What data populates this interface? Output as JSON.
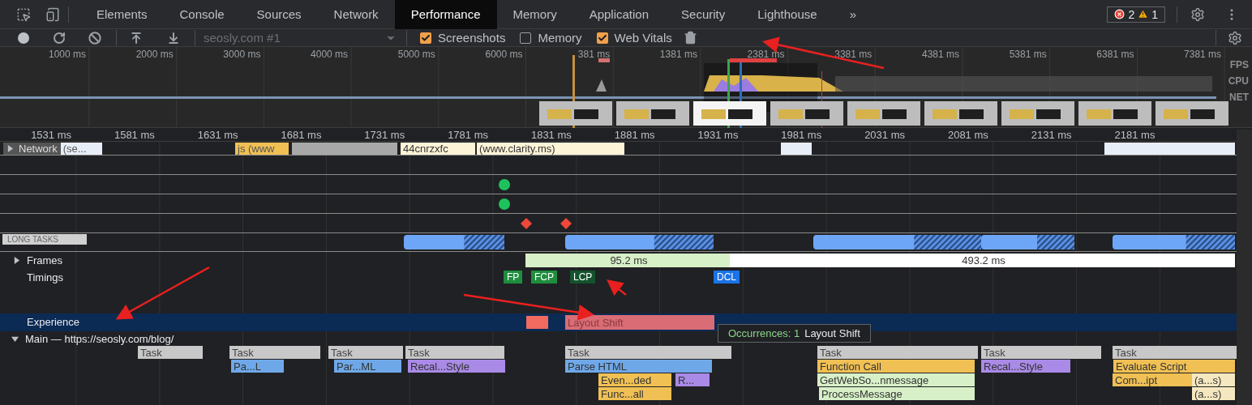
{
  "tabs": [
    {
      "label": "Elements",
      "selected": false
    },
    {
      "label": "Console",
      "selected": false
    },
    {
      "label": "Sources",
      "selected": false
    },
    {
      "label": "Network",
      "selected": false
    },
    {
      "label": "Performance",
      "selected": true
    },
    {
      "label": "Memory",
      "selected": false
    },
    {
      "label": "Application",
      "selected": false
    },
    {
      "label": "Security",
      "selected": false
    },
    {
      "label": "Lighthouse",
      "selected": false
    }
  ],
  "more_tabs": "»",
  "issues": {
    "errors": "2",
    "warnings": "1"
  },
  "toolbar": {
    "profile_select": "seosly.com #1",
    "checkboxes": [
      {
        "label": "Screenshots",
        "checked": true
      },
      {
        "label": "Memory",
        "checked": false
      },
      {
        "label": "Web Vitals",
        "checked": true
      }
    ]
  },
  "overview": {
    "ticks": [
      "1000 ms",
      "2000 ms",
      "3000 ms",
      "4000 ms",
      "5000 ms",
      "6000 ms",
      "381 ms",
      "1381 ms",
      "2381 ms",
      "3381 ms",
      "4381 ms",
      "5381 ms",
      "6381 ms",
      "7381 ms"
    ],
    "lane_labels": [
      "FPS",
      "CPU",
      "NET"
    ]
  },
  "ruler": [
    "1531 ms",
    "1581 ms",
    "1631 ms",
    "1681 ms",
    "1731 ms",
    "1781 ms",
    "1831 ms",
    "1881 ms",
    "1931 ms",
    "1981 ms",
    "2031 ms",
    "2081 ms",
    "2131 ms",
    "2181 ms"
  ],
  "network": {
    "label": "Network",
    "expanded": false,
    "requests": [
      "(se...",
      "js (www",
      "44cnrzxfc",
      "(www.clarity.ms)"
    ]
  },
  "long_tasks": {
    "label": "LONG TASKS"
  },
  "frames": {
    "label": "Frames",
    "expanded": false,
    "durations": [
      "95.2 ms",
      "493.2 ms"
    ]
  },
  "timings": {
    "label": "Timings",
    "markers": [
      {
        "label": "FP",
        "color": "#1e8e3e"
      },
      {
        "label": "FCP",
        "color": "#1e8e3e"
      },
      {
        "label": "LCP",
        "color": "#14532d"
      },
      {
        "label": "DCL",
        "color": "#1a73e8"
      }
    ]
  },
  "experience": {
    "label": "Experience",
    "selected": true,
    "events": [
      "Layout Shift"
    ]
  },
  "tooltip": {
    "count": "Occurrences: 1",
    "text": "Layout Shift"
  },
  "main": {
    "label": "Main — https://seosly.com/blog/",
    "expanded": true,
    "rows": [
      {
        "events": [
          {
            "label": "Task",
            "kind": "task"
          },
          {
            "label": "Task",
            "kind": "task"
          },
          {
            "label": "Task",
            "kind": "task"
          },
          {
            "label": "Task",
            "kind": "task"
          },
          {
            "label": "Task",
            "kind": "task"
          },
          {
            "label": "Task",
            "kind": "task"
          },
          {
            "label": "Task",
            "kind": "task"
          },
          {
            "label": "Task",
            "kind": "task"
          }
        ]
      },
      {
        "events": [
          {
            "label": "Pa...L",
            "kind": "parse"
          },
          {
            "label": "Par...ML",
            "kind": "parse"
          },
          {
            "label": "Recal...Style",
            "kind": "style"
          },
          {
            "label": "Parse HTML",
            "kind": "parse"
          },
          {
            "label": "Function Call",
            "kind": "script"
          },
          {
            "label": "Recal...Style",
            "kind": "style"
          },
          {
            "label": "Evaluate Script",
            "kind": "script"
          }
        ]
      },
      {
        "events": [
          {
            "label": "Even...ded",
            "kind": "script"
          },
          {
            "label": "R...",
            "kind": "style"
          },
          {
            "label": "GetWebSo...nmessage",
            "kind": "message"
          },
          {
            "label": "Com...ipt",
            "kind": "script"
          },
          {
            "label": "(a...s)",
            "kind": "anon"
          }
        ]
      },
      {
        "events": [
          {
            "label": "Func...all",
            "kind": "script"
          },
          {
            "label": "ProcessMessage",
            "kind": "message"
          },
          {
            "label": "(a...s)",
            "kind": "anon"
          }
        ]
      }
    ]
  }
}
